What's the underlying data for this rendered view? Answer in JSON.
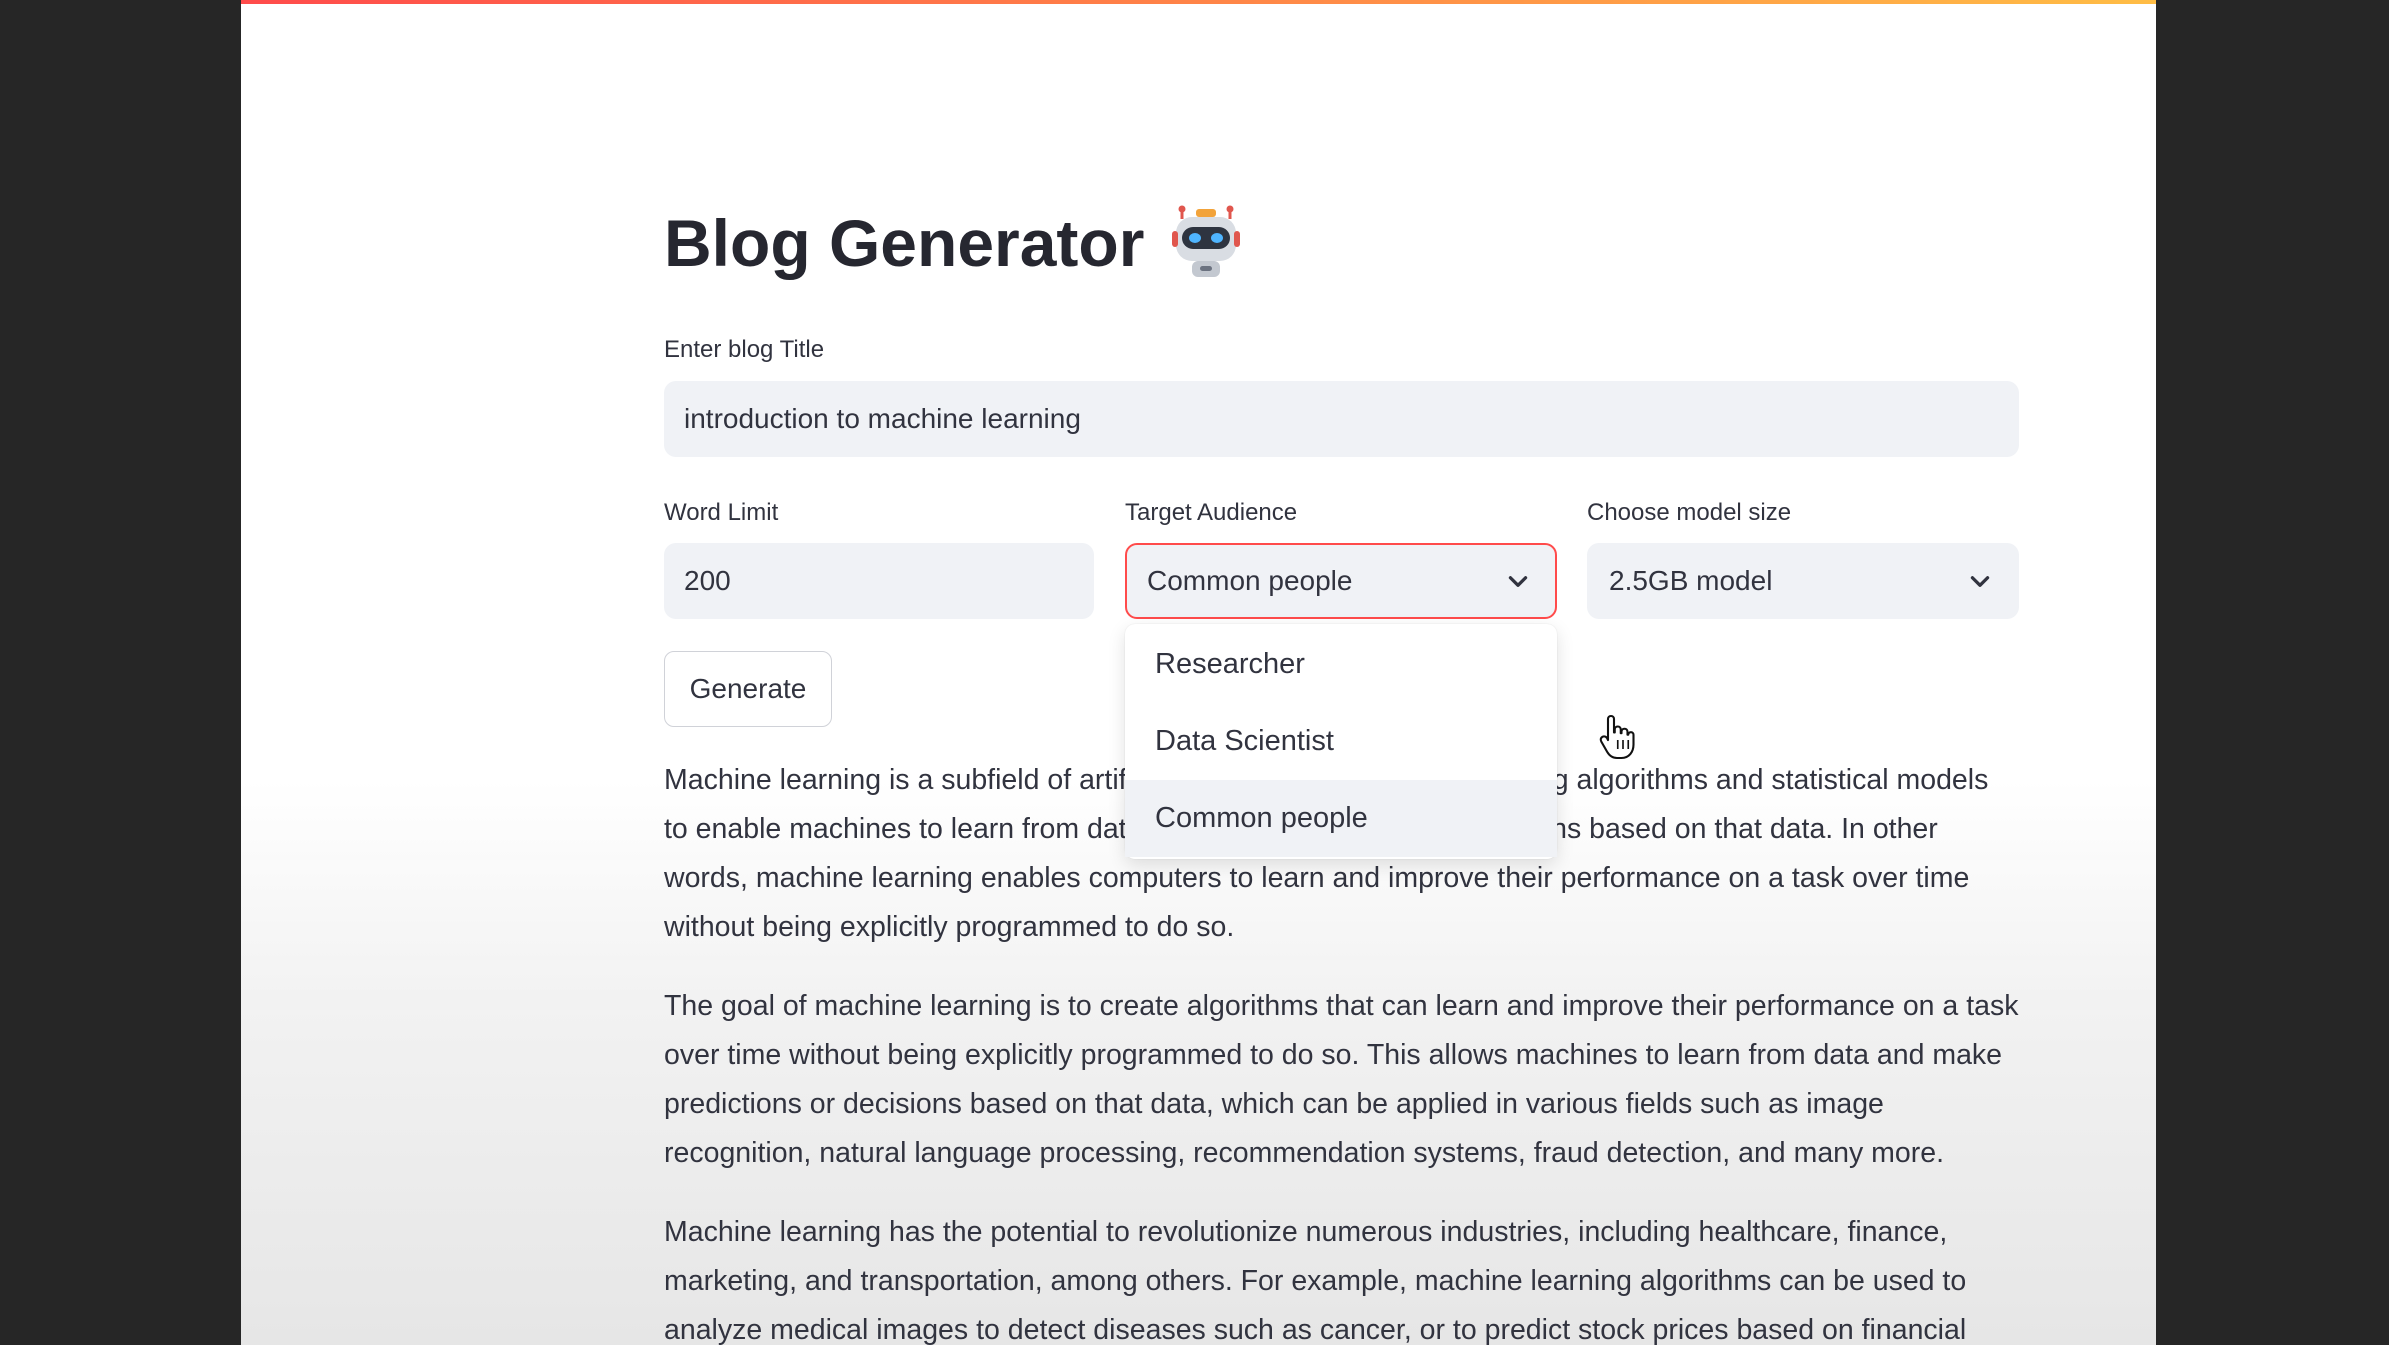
{
  "app": {
    "title": "Blog Generator",
    "title_icon": "robot-icon"
  },
  "form": {
    "blog_title": {
      "label": "Enter blog Title",
      "value": "introduction to machine learning"
    },
    "word_limit": {
      "label": "Word Limit",
      "value": "200"
    },
    "target_audience": {
      "label": "Target Audience",
      "selected": "Common people",
      "options": [
        "Researcher",
        "Data Scientist",
        "Common people"
      ],
      "expanded": true
    },
    "model_size": {
      "label": "Choose model size",
      "selected": "2.5GB model"
    },
    "generate_label": "Generate"
  },
  "output": {
    "paragraphs": [
      "Machine learning is a subfield of artificial intelligence that involves using algorithms and statistical models to enable machines to learn from data and make predictions or decisions based on that data. In other words, machine learning enables computers to learn and improve their performance on a task over time without being explicitly programmed to do so.",
      "The goal of machine learning is to create algorithms that can learn and improve their performance on a task over time without being explicitly programmed to do so. This allows machines to learn from data and make predictions or decisions based on that data, which can be applied in various fields such as image recognition, natural language processing, recommendation systems, fraud detection, and many more.",
      "Machine learning has the potential to revolutionize numerous industries, including healthcare, finance, marketing, and transportation, among others. For example, machine learning algorithms can be used to analyze medical images to detect diseases such as cancer, or to predict stock prices based on financial"
    ]
  },
  "colors": {
    "accent": "#ff4b4b",
    "accent_secondary": "#ffbd45",
    "input_bg": "#f0f2f6",
    "text": "#31333f",
    "backdrop": "#262626"
  },
  "pointer": "hand-pointer-icon"
}
